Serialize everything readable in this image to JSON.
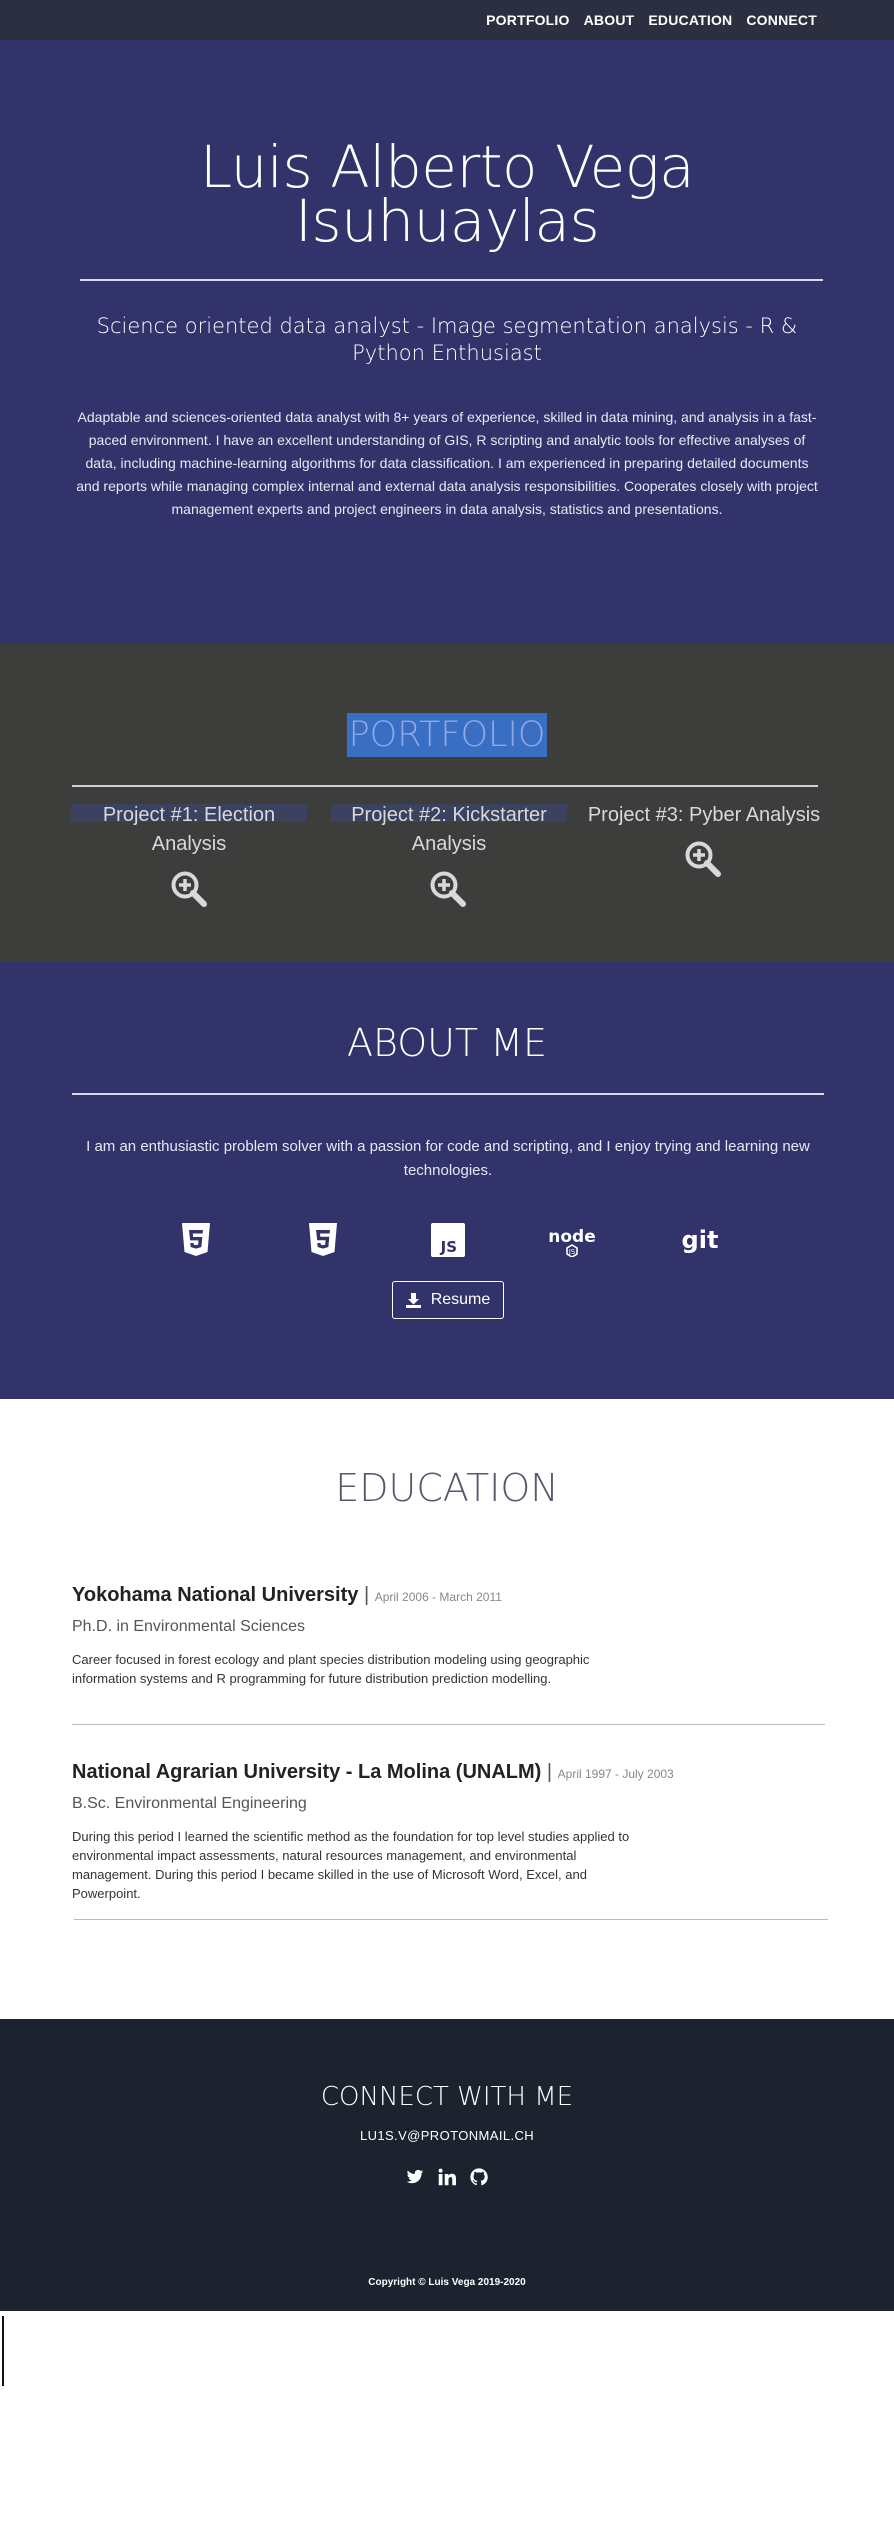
{
  "nav": {
    "items": [
      "PORTFOLIO",
      "ABOUT",
      "EDUCATION",
      "CONNECT"
    ]
  },
  "hero": {
    "name_line1": "Luis Alberto Vega",
    "name_line2": "Isuhuaylas",
    "subtitle": "Science oriented data analyst - Image segmentation analysis - R & Python Enthusiast",
    "bio": "Adaptable and sciences-oriented data analyst with 8+ years of experience, skilled in data mining, and analysis in a fast-paced environment. I have an excellent understanding of GIS, R scripting and analytic tools for effective analyses of data, including machine-learning algorithms for data classification. I am experienced in preparing detailed documents and reports while managing complex internal and external data analysis responsibilities. Cooperates closely with project management experts and project engineers in data analysis, statistics and presentations."
  },
  "portfolio": {
    "title": "PORTFOLIO",
    "projects": [
      {
        "title": "Project #1: Election Analysis",
        "icon": "zoom-in-icon"
      },
      {
        "title": "Project #2: Kickstarter Analysis",
        "icon": "zoom-in-icon"
      },
      {
        "title": "Project #3: Pyber Analysis",
        "icon": "zoom-in-icon"
      }
    ]
  },
  "about": {
    "title": "ABOUT ME",
    "text": "I am an enthusiastic problem solver with a passion for code and scripting, and I enjoy trying and learning new technologies.",
    "tech_icons": [
      "html5-icon",
      "css3-icon",
      "javascript-icon",
      "nodejs-icon",
      "git-icon"
    ],
    "resume_label": "Resume"
  },
  "education": {
    "title": "EDUCATION",
    "schools": [
      {
        "name": "Yokohama National University",
        "separator": "|",
        "dates": "April 2006 - March 2011",
        "degree": "Ph.D. in Environmental Sciences",
        "description": "Career focused in forest ecology and plant species distribution modeling using geographic information systems and R programming for future distribution prediction modelling."
      },
      {
        "name": "National Agrarian University - La Molina (UNALM)",
        "separator": "|",
        "dates": "April 1997 - July 2003",
        "degree": "B.Sc. Environmental Engineering",
        "description": "During this period I learned the scientific method as the foundation for top level studies applied to environmental impact assessments, natural resources management, and environmental management. During this period I became skilled in the use of Microsoft Word, Excel, and Powerpoint."
      }
    ]
  },
  "footer": {
    "title": "CONNECT WITH ME",
    "email": "LU1S.V@PROTONMAIL.CH",
    "social_icons": [
      "twitter-icon",
      "linkedin-icon",
      "github-icon"
    ],
    "copyright": "Copyright © Luis Vega 2019-2020"
  },
  "colors": {
    "nav_bg": "#2c2f40",
    "hero_bg": "#32336b",
    "portfolio_bg": "#3d3e3c",
    "footer_bg": "#1c232e",
    "portfolio_highlight": "#3a6ec2"
  }
}
